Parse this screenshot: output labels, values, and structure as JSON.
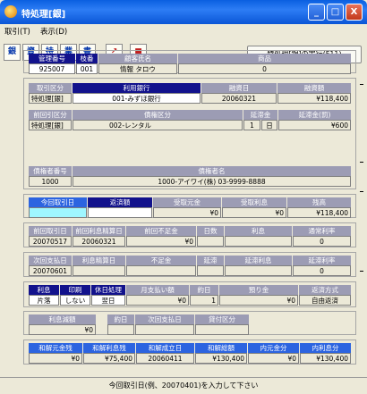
{
  "window": {
    "title": "特処理[銀]",
    "min": "_",
    "max": "□",
    "close": "X"
  },
  "menu": [
    "取引(T)",
    "表示(D)"
  ],
  "toolbar": {
    "t1": "銀",
    "t2": "資",
    "t3": "持",
    "t4": "業",
    "t5": "書",
    "t6": "↗",
    "t7": "■",
    "exec": "特処理[銀]の実行(F11)"
  },
  "customer": {
    "labels": {
      "mgmt_no": "管理番号",
      "branch_no": "枝番",
      "name": "顧客氏名",
      "product": "商品"
    },
    "values": {
      "mgmt_no": "925007",
      "branch_no": "001",
      "name": "情報 タロウ",
      "product": "0"
    }
  },
  "trade": {
    "labels": {
      "kind": "取引区分",
      "bank": "利用銀行",
      "date": "融資日",
      "amount": "融資額"
    },
    "values": {
      "kind": "特処理[銀]",
      "bank": "001-みずほ銀行",
      "date": "20060321",
      "amount": "¥118,400"
    }
  },
  "prev": {
    "labels": {
      "kind": "前回引区分",
      "credit_kind": "債権区分",
      "delay_count": "延滞金",
      "delay_amount": "延滞金(罰)"
    },
    "values": {
      "kind": "特処理[銀]",
      "credit_kind": "002-レンタル",
      "delay_n": "1",
      "delay_unit": "日",
      "delay_amount": "¥600"
    }
  },
  "debtor": {
    "labels": {
      "no": "債権者番号",
      "name": "債権者名"
    },
    "values": {
      "no": "1000",
      "name": "1000-アイワイ(株) 03-9999-8888"
    }
  },
  "current": {
    "labels": {
      "date": "今回取引日",
      "repay": "返済額",
      "principal": "受取元金",
      "interest": "受取利息",
      "balance": "残高"
    },
    "values": {
      "date": "",
      "repay": "",
      "principal": "¥0",
      "interest": "¥0",
      "balance": "¥118,400"
    }
  },
  "last": {
    "labels": {
      "date": "前回取引日",
      "calc_date": "前回利息精算日",
      "shortage": "前回不足金",
      "days": "日数",
      "interest": "利息",
      "rate": "通常利率"
    },
    "values": {
      "date": "20070517",
      "calc_date": "20060321",
      "shortage": "¥0",
      "days": "",
      "interest": "",
      "rate": "0"
    }
  },
  "next": {
    "labels": {
      "pay_date": "次回支払日",
      "calc_date": "利息精算日",
      "shortage": "不足金",
      "delay": "延滞",
      "delay_interest": "延滞利息",
      "delay_rate": "延滞利率"
    },
    "values": {
      "pay_date": "20070601",
      "calc_date": "",
      "shortage": "",
      "delay": "",
      "delay_interest": "",
      "delay_rate": "0"
    }
  },
  "payment": {
    "labels": {
      "interest": "利息",
      "print": "印刷",
      "holiday": "休日処理",
      "monthly": "月支払い額",
      "day": "約日",
      "deposit": "預り金",
      "method": "返済方式"
    },
    "values": {
      "interest": "片落",
      "print": "しない",
      "holiday": "翌日",
      "monthly": "¥0",
      "day": "1",
      "deposit": "¥0",
      "method": "自由返済"
    }
  },
  "reduce": {
    "labels": {
      "amount": "利息減額",
      "day": "約日",
      "next_pay": "次回支払日",
      "guarantee": "貸付区分"
    },
    "values": {
      "amount": "¥0",
      "day": "",
      "next_pay": "",
      "guarantee": ""
    }
  },
  "settle": {
    "labels": {
      "principal": "和解元金残",
      "interest": "和解利息残",
      "date": "和解成立日",
      "total": "和解総額",
      "inner_principal": "内元金分",
      "inner_interest": "内利息分"
    },
    "values": {
      "principal": "¥0",
      "interest": "¥75,400",
      "date": "20060411",
      "total": "¥130,400",
      "inner_principal": "¥0",
      "inner_interest": "¥130,400"
    }
  },
  "status": "今回取引日(例、20070401)を入力して下さい"
}
